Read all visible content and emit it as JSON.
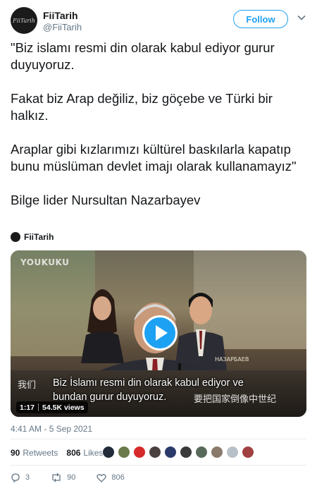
{
  "user": {
    "name": "FiiTarih",
    "handle": "@FiiTarih",
    "avatar_text": "FiiTarih"
  },
  "header": {
    "follow_label": "Follow"
  },
  "tweet": {
    "text": "\"Biz islamı resmi din olarak kabul ediyor gurur duyuyoruz.\n\nFakat biz Arap değiliz, biz göçebe ve Türki bir halkız.\n\nAraplar gibi kızlarımızı kültürel baskılarla kapatıp bunu müslüman devlet imajı olarak kullanamayız\"\n\nBilge lider Nursultan Nazarbayev"
  },
  "media": {
    "source_name": "FiiTarih",
    "watermark": "YOUKUKU",
    "subtitle": "Biz İslamı resmi din olarak kabul ediyor ve bundan gurur duyuyoruz.",
    "cn_left": "我们",
    "cn_right": "要把国家倒像中世纪",
    "name_tag": "НАЗАРБАЕВ",
    "duration": "1:17",
    "views": "54.5K views"
  },
  "timestamp": "4:41 AM - 5 Sep 2021",
  "stats": {
    "retweets_count": "90",
    "retweets_label": "Retweets",
    "likes_count": "806",
    "likes_label": "Likes"
  },
  "actions": {
    "replies": "3",
    "retweets": "90",
    "likes": "806"
  },
  "colors": {
    "accent": "#1da1f2",
    "text": "#14171a",
    "muted": "#657786"
  }
}
